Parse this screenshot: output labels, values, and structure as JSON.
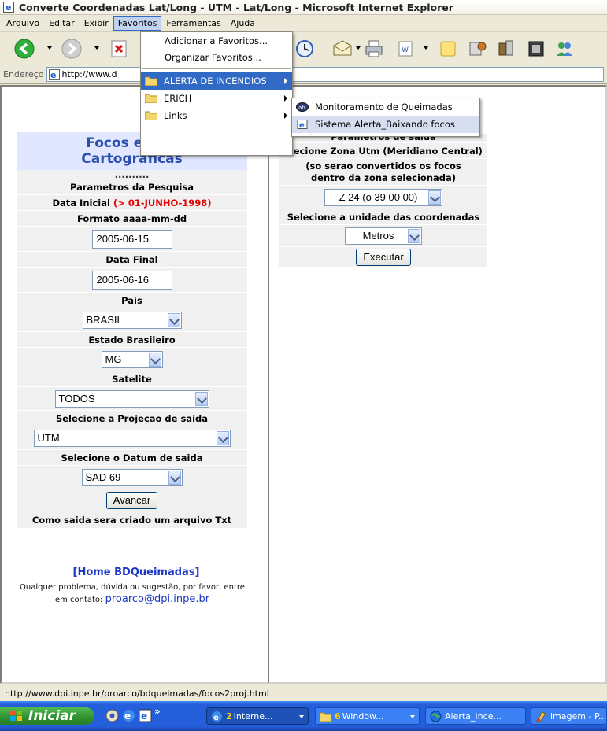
{
  "window": {
    "title": "Converte Coordenadas Lat/Long - UTM - Lat/Long - Microsoft Internet Explorer"
  },
  "menubar": {
    "items": [
      "Arquivo",
      "Editar",
      "Exibir",
      "Favoritos",
      "Ferramentas",
      "Ajuda"
    ],
    "open_item": "Favoritos"
  },
  "address": {
    "label": "Endereço",
    "value": "http://www.d"
  },
  "favorites_menu": {
    "add": "Adicionar a Favoritos...",
    "organize": "Organizar Favoritos...",
    "folders": [
      "ALERTA DE INCENDIOS",
      "ERICH",
      "Links"
    ]
  },
  "submenu": {
    "items": [
      "Monitoramento de Queimadas",
      "Sistema Alerta_Baixando focos"
    ]
  },
  "left_form": {
    "heading_line1": "Focos em Pr",
    "heading_line2": "Cartográficas",
    "dots": "..........",
    "params_title": "Parametros da Pesquisa",
    "start_label": "Data Inicial ",
    "start_note": "(> 01-JUNHO-1998)",
    "format_label": "Formato aaaa-mm-dd",
    "start_value": "2005-06-15",
    "end_label": "Data Final",
    "end_value": "2005-06-16",
    "country_label": "Pais",
    "country_value": "BRASIL",
    "state_label": "Estado Brasileiro",
    "state_value": "MG",
    "satellite_label": "Satelite",
    "satellite_value": "TODOS",
    "projection_label": "Selecione a Projecao de saida",
    "projection_value": "UTM",
    "datum_label": "Selecione o Datum de saida",
    "datum_value": "SAD 69",
    "advance_button": "Avancar",
    "output_note": "Como saida sera criado um arquivo Txt",
    "home_link": "[Home BDQueimadas]",
    "contact_text": "Qualquer problema, dúvida ou sugestão, por favor, entre em contato:",
    "contact_email": "proarco@dpi.inpe.br"
  },
  "right_form": {
    "title": "Parametros de saida",
    "zone_label": "elecione Zona Utm (Meridiano Central)",
    "zone_note": "(so serao convertidos os focos dentro da zona selecionada)",
    "zone_value": "Z 24 (o 39 00 00)",
    "unit_label": "Selecione a unidade das coordenadas",
    "unit_value": "Metros",
    "execute_button": "Executar"
  },
  "statusbar": {
    "url": "http://www.dpi.inpe.br/proarco/bdqueimadas/focos2proj.html"
  },
  "taskbar": {
    "start": "Iniciar",
    "chevron": "»",
    "tasks": [
      {
        "num": "2",
        "label": "Interne..."
      },
      {
        "num": "6",
        "label": "Window..."
      },
      {
        "num": "",
        "label": "Alerta_Ince..."
      },
      {
        "num": "",
        "label": "imagem - P..."
      }
    ]
  }
}
